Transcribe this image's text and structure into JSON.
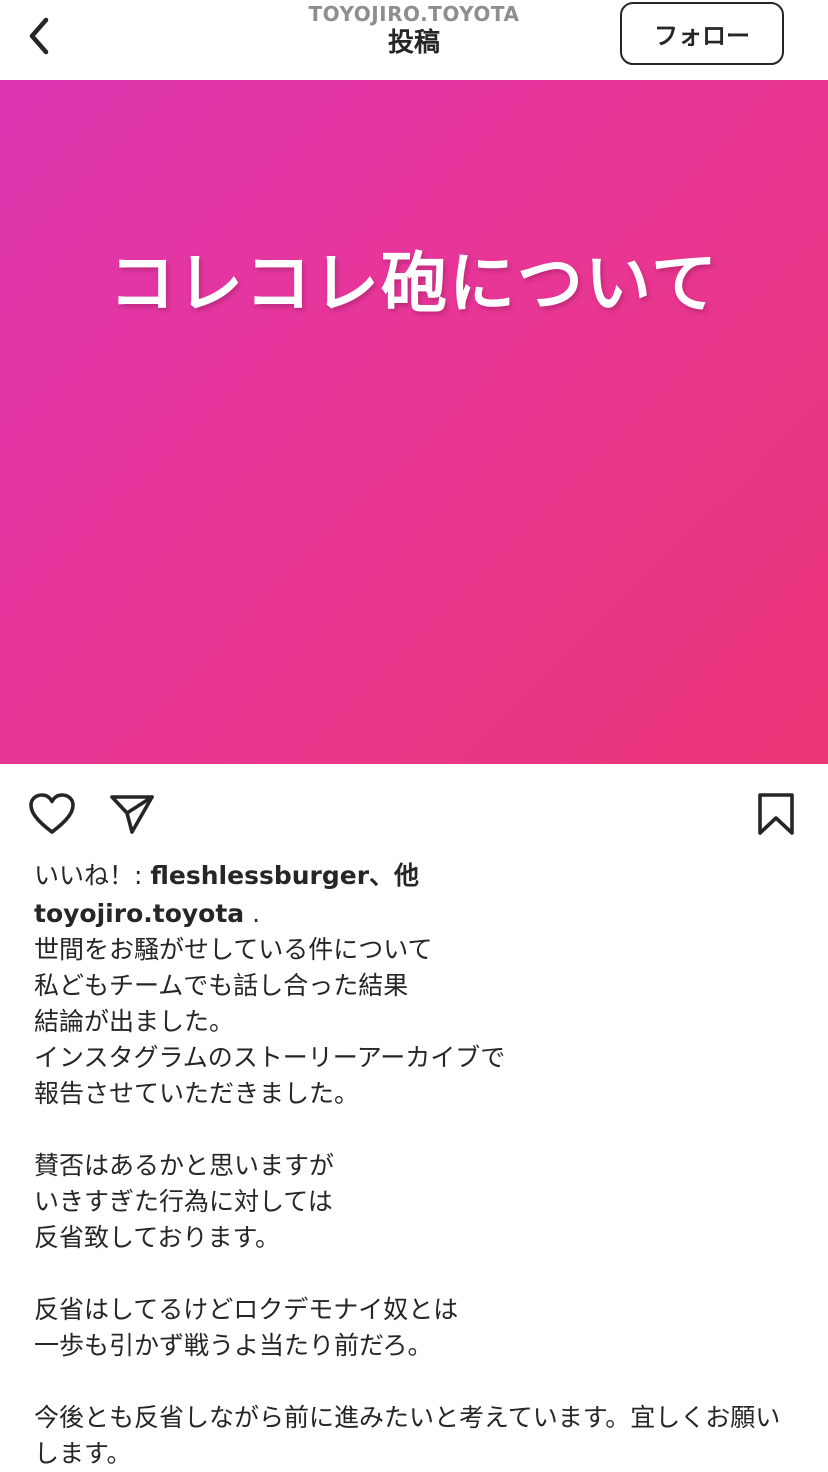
{
  "header": {
    "username": "TOYOJIRO.TOYOTA",
    "title": "投稿",
    "back_icon": "chevron-left-icon",
    "follow_label": "フォロー"
  },
  "post": {
    "image_text": "コレコレ砲について",
    "image_gradient": [
      "#dd36b2",
      "#e83697",
      "#ea3576"
    ]
  },
  "actions": {
    "like_icon": "heart-icon",
    "share_icon": "paper-plane-icon",
    "save_icon": "bookmark-icon"
  },
  "likes": {
    "prefix": "いいね！: ",
    "user": "fleshlessburger",
    "suffix": "、他"
  },
  "caption": {
    "author": "toyojiro.toyota",
    "first_line": " .",
    "body": "世間をお騒がせしている件について\n私どもチームでも話し合った結果\n結論が出ました。\nインスタグラムのストーリーアーカイブで\n報告させていただきました。\n\n賛否はあるかと思いますが\nいきすぎた行為に対しては\n反省致しております。\n\n反省はしてるけどロクデモナイ奴とは\n一歩も引かず戦うよ当たり前だろ。\n\n今後とも反省しながら前に進みたいと考えています。宜しくお願いします。"
  }
}
